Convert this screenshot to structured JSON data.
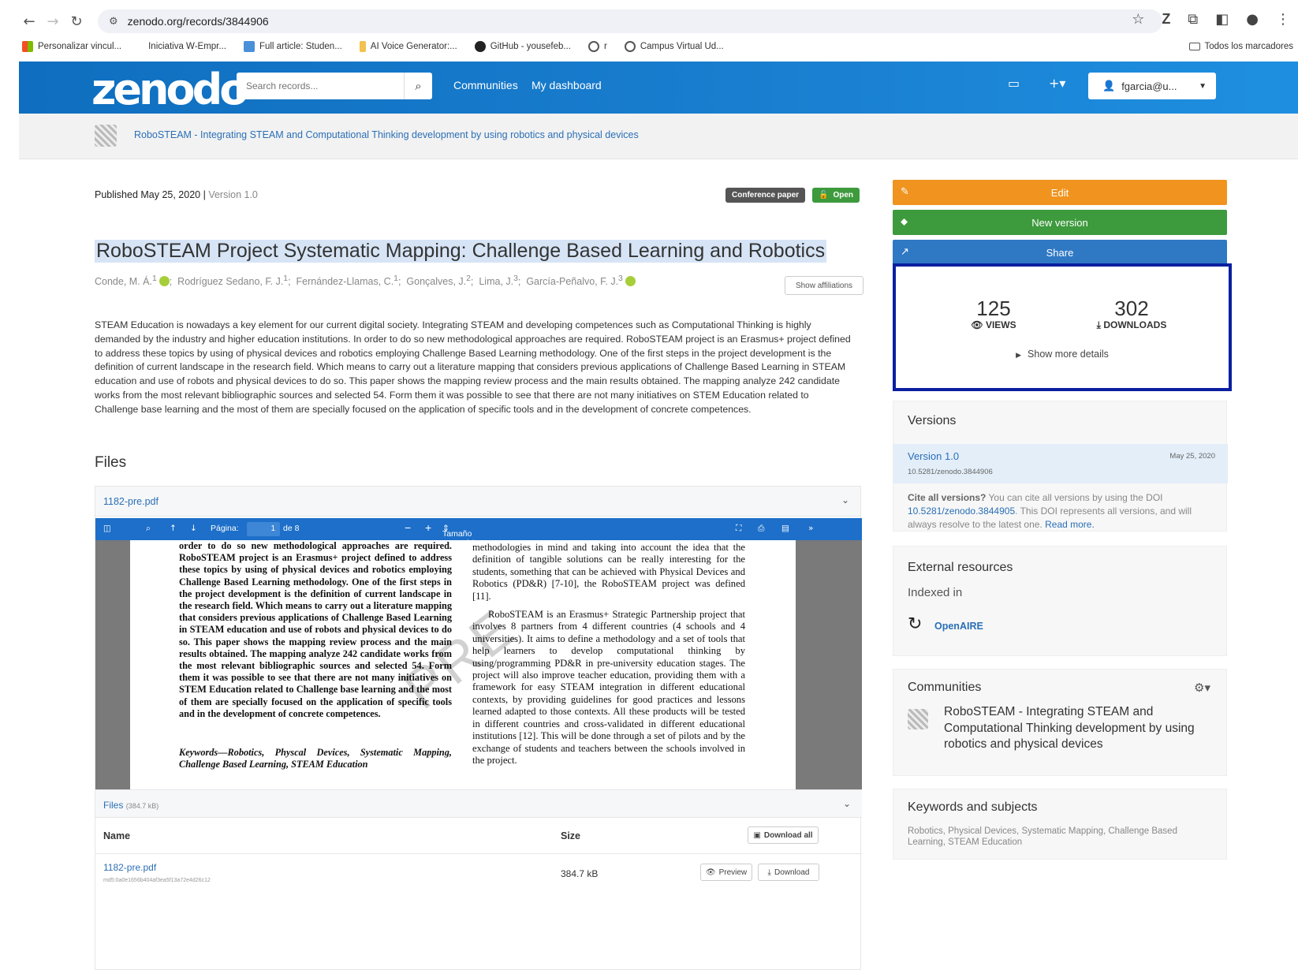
{
  "browser": {
    "url": "zenodo.org/records/3844906",
    "bookmarks": [
      {
        "label": "Personalizar vincul...",
        "color": "#e84c3d"
      },
      {
        "label": "Iniciativa W-Empr...",
        "color": "transparent"
      },
      {
        "label": "Full article: Studen...",
        "color": "#4a90d9"
      },
      {
        "label": "AI Voice Generator:...",
        "color": "#f2c14e"
      },
      {
        "label": "GitHub - yousefeb...",
        "color": "#222"
      },
      {
        "label": "r",
        "color": "#666"
      },
      {
        "label": "Campus Virtual Ud...",
        "color": "#666"
      }
    ],
    "all_bookmarks": "Todos los marcadores"
  },
  "header": {
    "logo": "zenodo",
    "search_placeholder": "Search records...",
    "nav": [
      "Communities",
      "My dashboard"
    ],
    "user": "fgarcia@u..."
  },
  "community_bar": {
    "link": "RoboSTEAM - Integrating STEAM and Computational Thinking development by using robotics and physical devices"
  },
  "record": {
    "published": "Published May 25, 2020",
    "version": "Version 1.0",
    "badges": {
      "type": "Conference paper",
      "access": "Open"
    },
    "title": "RoboSTEAM Project Systematic Mapping: Challenge Based Learning and Robotics",
    "authors": [
      "Conde, M. Á.",
      "Rodríguez Sedano, F. J.",
      "Fernández-Llamas, C.",
      "Gonçalves, J.",
      "Lima, J.",
      "García-Peñalvo, F. J."
    ],
    "author_sup": [
      "1",
      "1",
      "1",
      "2",
      "3",
      "3"
    ],
    "show_affiliations": "Show affiliations",
    "abstract": "STEAM Education is nowadays a key element for our current digital society. Integrating STEAM and developing competences such as Computational Thinking is highly demanded by the industry and higher education institutions. In order to do so new methodological approaches are required. RoboSTEAM project is an Erasmus+ project defined to address these topics by using of physical devices and robotics employing Challenge Based Learning methodology. One of the first steps in the project development is the definition of current landscape in the research field. Which means to carry out a literature mapping that considers previous applications of Challenge Based Learning in STEAM education and use of robots and physical devices to do so. This paper shows the mapping review process and the main results obtained. The mapping analyze 242 candidate works from the most relevant bibliographic sources and selected 54. Form them it was possible to see that there are not many initiatives on STEM Education related to Challenge base learning and the most of them are specially focused on the application of specific tools and in the development of concrete competences."
  },
  "files": {
    "heading": "Files",
    "preview_file": "1182-pre.pdf",
    "pdf_toolbar": {
      "page_label": "Página:",
      "page": "1",
      "of": "de 8",
      "zoom": "Tamaño automático"
    },
    "pdf_col1": "order to do so new methodological approaches are required. RoboSTEAM project is an Erasmus+ project defined to address these topics by using of physical devices and robotics employing Challenge Based Learning methodology. One of the first steps in the project development is the definition of current landscape in the research field. Which means to carry out a literature mapping that considers previous applications of Challenge Based Learning in STEAM education and use of robots and physical devices to do so. This paper shows the mapping review process and the main results obtained. The mapping analyze 242 candidate works from the most relevant bibliographic sources and selected 54. Form them it was possible to see that there are not many initiatives on STEM Education related to Challenge base learning and the most of them are specially focused on the application of specific tools and in the development of concrete competences.",
    "pdf_keywords": "Keywords—Robotics, Physcal Devices, Systematic Mapping, Challenge Based Learning, STEAM Education",
    "pdf_col2_p1": "methodologies in mind and taking into account the idea that the definition of tangible solutions can be really interesting for the students, something that can be achieved with Physical Devices and Robotics (PD&R) [7-10], the RoboSTEAM project was defined [11].",
    "pdf_col2_p2": "RoboSTEAM is an Erasmus+ Strategic Partnership project that involves 8 partners from 4 different countries (4 schools and 4 universities). It aims to define a methodology and a set of tools that help learners to develop computational thinking by using/programming PD&R in pre-university education stages. The project will also improve teacher education, providing them with a framework for easy STEAM integration in different educational contexts, by providing guidelines for good practices and lessons learned adapted to those contexts. All these products will be tested in different countries and cross-validated in different educational institutions [12]. This will be done through a set of pilots and by the exchange of students and teachers between the schools involved in the project.",
    "watermark": "PRE",
    "list_label": "Files",
    "list_size": "(384.7 kB)",
    "col_name": "Name",
    "col_size": "Size",
    "download_all": "Download all",
    "row": {
      "name": "1182-pre.pdf",
      "md5": "md5:0a0e1656b404af3ea5f13a72e4d26c12",
      "size": "384.7 kB",
      "preview": "Preview",
      "download": "Download"
    }
  },
  "sidebar": {
    "edit": "Edit",
    "new_version": "New version",
    "share": "Share",
    "views": "125",
    "views_label": "VIEWS",
    "downloads": "302",
    "downloads_label": "DOWNLOADS",
    "more_details": "Show more details",
    "versions": {
      "heading": "Versions",
      "item": "Version 1.0",
      "doi": "10.5281/zenodo.3844906",
      "date": "May 25, 2020",
      "cite_bold": "Cite all versions?",
      "cite_text": "You can cite all versions by using the DOI",
      "cite_doi": "10.5281/zenodo.3844905",
      "cite_rest": ". This DOI represents all versions, and will always resolve to the latest one.",
      "read_more": "Read more."
    },
    "external": {
      "heading": "External resources",
      "indexed": "Indexed in",
      "openaire": "OpenAIRE"
    },
    "communities": {
      "heading": "Communities",
      "item": "RoboSTEAM - Integrating STEAM and Computational Thinking development by using robotics and physical devices"
    },
    "keywords": {
      "heading": "Keywords and subjects",
      "text": "Robotics, Physical Devices, Systematic Mapping, Challenge Based Learning, STEAM Education"
    }
  },
  "colors": {
    "edit": "#f0941f",
    "new_version": "#3d9a3d",
    "share": "#2f78c4",
    "highlight_box": "#0a1fa0",
    "conference_badge": "#555555",
    "open_badge": "#3d9a3d"
  }
}
